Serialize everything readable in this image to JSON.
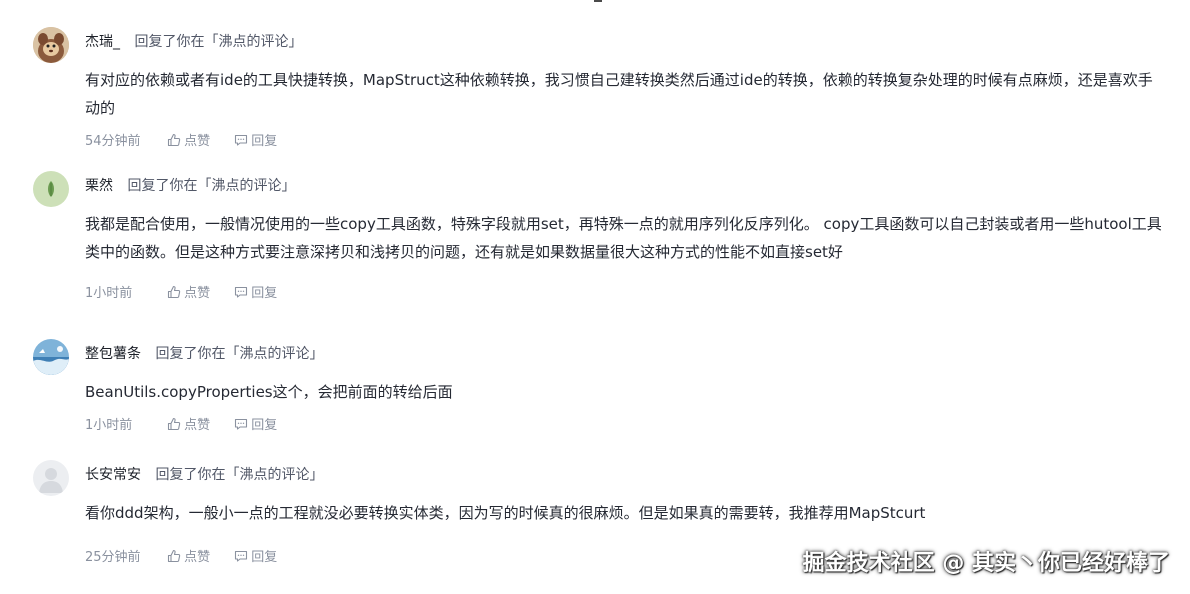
{
  "comments": [
    {
      "username": "杰瑞_",
      "reply_info": "回复了你在「沸点的评论」",
      "content": "有对应的依赖或者有ide的工具快捷转换，MapStruct这种依赖转换，我习惯自己建转换类然后通过ide的转换，依赖的转换复杂处理的时候有点麻烦，还是喜欢手动的",
      "time": "54分钟前",
      "like_label": "点赞",
      "reply_label": "回复"
    },
    {
      "username": "栗然",
      "reply_info": "回复了你在「沸点的评论」",
      "content": "我都是配合使用，一般情况使用的一些copy工具函数，特殊字段就用set，再特殊一点的就用序列化反序列化。 copy工具函数可以自己封装或者用一些hutool工具类中的函数。但是这种方式要注意深拷贝和浅拷贝的问题，还有就是如果数据量很大这种方式的性能不如直接set好",
      "time": "1小时前",
      "like_label": "点赞",
      "reply_label": "回复"
    },
    {
      "username": "整包薯条",
      "reply_info": "回复了你在「沸点的评论」",
      "content": "BeanUtils.copyProperties这个，会把前面的转给后面",
      "time": "1小时前",
      "like_label": "点赞",
      "reply_label": "回复"
    },
    {
      "username": "长安常安",
      "reply_info": "回复了你在「沸点的评论」",
      "content": "看你ddd架构，一般小一点的工程就没必要转换实体类，因为写的时候真的很麻烦。但是如果真的需要转，我推荐用MapStcurt",
      "time": "25分钟前",
      "like_label": "点赞",
      "reply_label": "回复"
    }
  ],
  "watermark": "掘金技术社区 @ 其实丶你已经好棒了"
}
